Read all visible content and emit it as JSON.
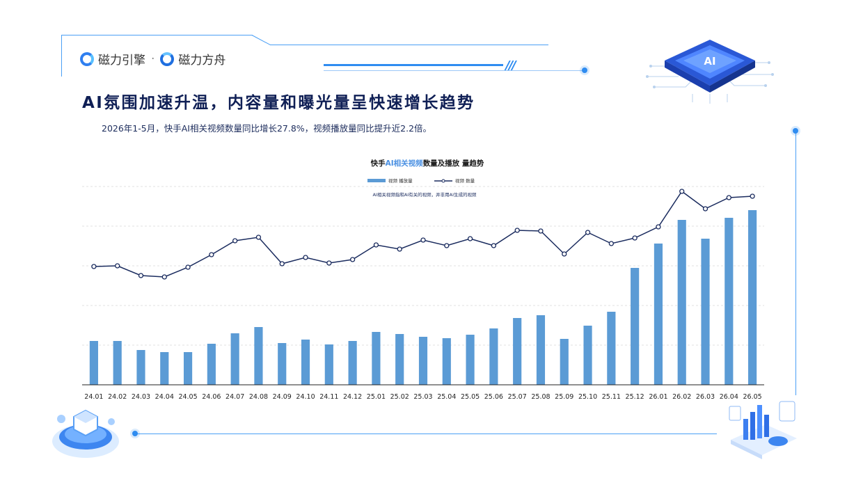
{
  "brand": {
    "logo1": "磁力引擎",
    "separator": "·",
    "logo2": "磁力方舟",
    "chip_label": "AI"
  },
  "header": {
    "title": "AI氛围加速升温，内容量和曝光量呈快速增长趋势",
    "subtitle": "2026年1-5月，快手AI相关视频数量同比增长27.8%，视频播放量同比提升近2.2倍。"
  },
  "colors": {
    "accent": "#2f8cf0",
    "bar": "#5b9bd5",
    "line": "#1a2b5e",
    "title": "#0f1f55"
  },
  "chart_data": {
    "type": "bar",
    "title_prefix": "快手",
    "title_highlight": "AI相关视频",
    "title_suffix": "数量及播放 量趋势",
    "note": "AI相关视频指和AI有关的视频，并非用AI生成的视频",
    "categories": [
      "24.01",
      "24.02",
      "24.03",
      "24.04",
      "24.05",
      "24.06",
      "24.07",
      "24.08",
      "24.09",
      "24.10",
      "24.11",
      "24.12",
      "25.01",
      "25.02",
      "25.03",
      "25.04",
      "25.05",
      "25.06",
      "25.07",
      "25.08",
      "25.09",
      "25.10",
      "25.11",
      "25.12",
      "26.01",
      "26.02",
      "26.03",
      "26.04",
      "26.05"
    ],
    "series": [
      {
        "name": "视频 播放量",
        "type": "bar",
        "values": [
          63,
          63,
          50,
          47,
          47,
          59,
          74,
          83,
          60,
          65,
          58,
          63,
          76,
          73,
          69,
          67,
          72,
          81,
          96,
          100,
          66,
          85,
          105,
          168,
          203,
          237,
          210,
          240,
          251
        ]
      },
      {
        "name": "视频 数量",
        "type": "line",
        "values": [
          170,
          171,
          157,
          155,
          169,
          187,
          207,
          212,
          174,
          183,
          175,
          180,
          201,
          195,
          208,
          200,
          210,
          200,
          222,
          221,
          188,
          219,
          203,
          211,
          227,
          278,
          253,
          269,
          271
        ]
      }
    ],
    "ylim": [
      0,
      285
    ],
    "grid": true,
    "legend": "top-center"
  }
}
